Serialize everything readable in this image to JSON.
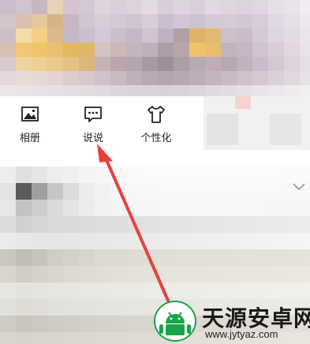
{
  "toolbar": {
    "items": [
      {
        "label": "相册",
        "icon": "photo-album-icon"
      },
      {
        "label": "说说",
        "icon": "chat-bubble-icon"
      },
      {
        "label": "个性化",
        "icon": "tshirt-icon"
      }
    ]
  },
  "watermark": {
    "title": "天源安卓网",
    "url": "www.jytyaz.com",
    "accent": "#1aa34a"
  },
  "annotation": {
    "arrow_color": "#e8413c"
  }
}
